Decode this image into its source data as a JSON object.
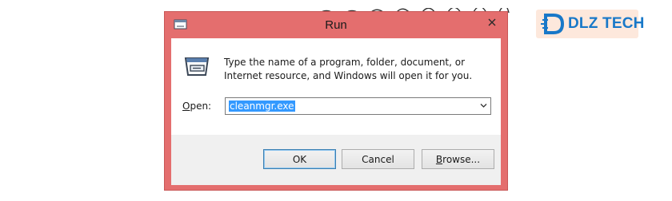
{
  "window": {
    "title": "Run",
    "description": "Type the name of a program, folder, document, or Internet resource, and Windows will open it for you.",
    "open_label_underlined": "O",
    "open_label_rest": "pen:",
    "open_value": "cleanmgr.exe",
    "title_icon": "run-app-icon",
    "close_icon": "close-icon"
  },
  "buttons": {
    "ok": "OK",
    "cancel": "Cancel",
    "browse_underlined": "B",
    "browse_rest": "rowse..."
  },
  "logo": {
    "text": "DLZ TECH"
  },
  "colors": {
    "titlebar": "#e46e6e",
    "selection": "#3399ff",
    "logo_blue": "#1878c8"
  }
}
